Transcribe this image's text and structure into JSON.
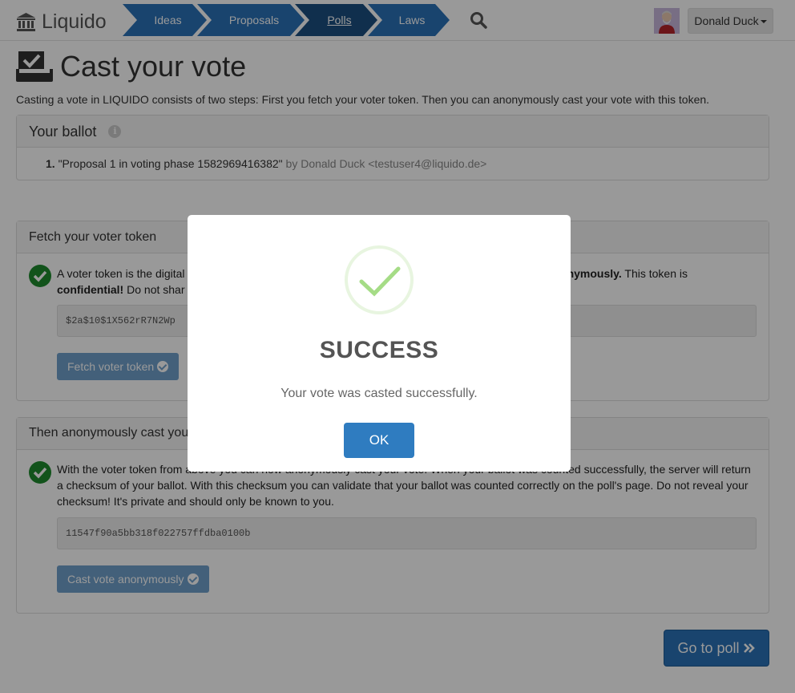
{
  "brand": {
    "name": "Liquido"
  },
  "nav": {
    "items": [
      {
        "label": "Ideas"
      },
      {
        "label": "Proposals"
      },
      {
        "label": "Polls",
        "active": true
      },
      {
        "label": "Laws"
      }
    ]
  },
  "user": {
    "name": "Donald Duck"
  },
  "page": {
    "title": "Cast your vote",
    "intro": "Casting a vote in LIQUIDO consists of two steps: First you fetch your voter token. Then you can anonymously cast your vote with this token."
  },
  "ballot": {
    "heading": "Your ballot",
    "item_number": "1.",
    "item_title": "\"Proposal 1 in voting phase 1582969416382\"",
    "item_author": "by Donald Duck <testuser4@liquido.de>"
  },
  "fetch": {
    "heading": "Fetch your voter token",
    "text_start": "A voter token is the digital",
    "text_bold1": "anonymously.",
    "text_mid_prefix": "d",
    "text_after_bold1": "This token is",
    "text_bold2": "confidential!",
    "text_after_bold2": "Do not shar",
    "token_value": "$2a$10$1X562rR7N2Wp",
    "button_label": "Fetch voter token"
  },
  "cast": {
    "heading": "Then anonymously cast you",
    "text": "With the voter token from above you can now anonymously cast your vote. When your ballot was counted successfully, the server will return a checksum of your ballot. With this checksum you can validate that your ballot was counted correctly on the poll's page. Do not reveal your checksum! It's private and should only be known to you.",
    "checksum_value": "11547f90a5bb318f022757ffdba0100b",
    "button_label": "Cast vote anonymously"
  },
  "goto_poll": {
    "label": "Go to poll"
  },
  "modal": {
    "title": "SUCCESS",
    "message": "Your vote was casted successfully.",
    "ok_label": "OK"
  },
  "colors": {
    "nav_blue": "#2a72b8",
    "nav_active": "#1c4f80",
    "success_green": "#1e8a2e",
    "modal_check": "#a5dc86"
  },
  "icons": {
    "brand": "bank-icon",
    "search": "search-icon",
    "title": "ballot-box-icon",
    "info": "info-icon",
    "check": "check-circle-icon",
    "goto": "double-chevron-right-icon"
  }
}
